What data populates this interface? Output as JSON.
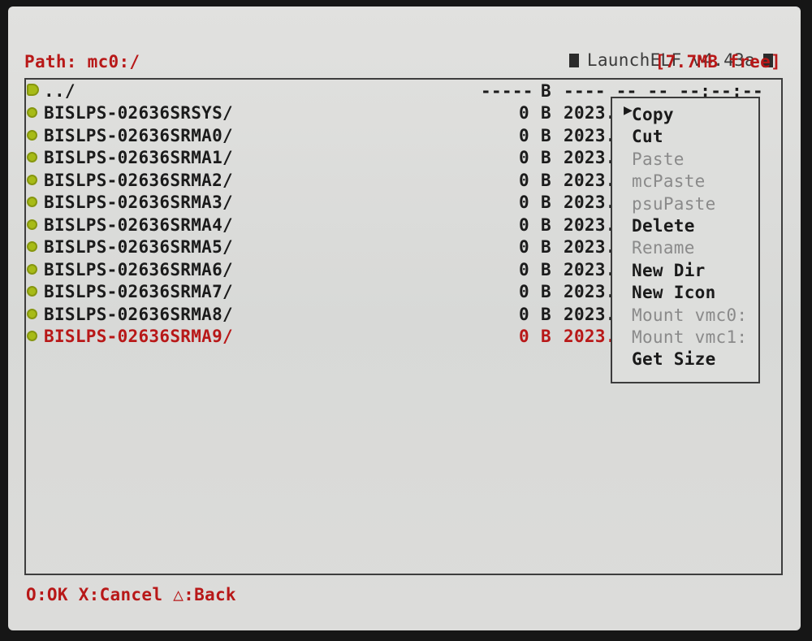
{
  "app": {
    "title": "LaunchELF v4.43a",
    "path": "Path: mc0:/",
    "free": "[7.7MB free]"
  },
  "files": {
    "header": {
      "name": "../",
      "size": "-----",
      "unit": "B",
      "date": "---- -- -- --:--:--"
    },
    "rows": [
      {
        "name": "BISLPS-02636SRSYS/",
        "size": "0",
        "unit": "B",
        "date": "2023."
      },
      {
        "name": "BISLPS-02636SRMA0/",
        "size": "0",
        "unit": "B",
        "date": "2023."
      },
      {
        "name": "BISLPS-02636SRMA1/",
        "size": "0",
        "unit": "B",
        "date": "2023."
      },
      {
        "name": "BISLPS-02636SRMA2/",
        "size": "0",
        "unit": "B",
        "date": "2023."
      },
      {
        "name": "BISLPS-02636SRMA3/",
        "size": "0",
        "unit": "B",
        "date": "2023."
      },
      {
        "name": "BISLPS-02636SRMA4/",
        "size": "0",
        "unit": "B",
        "date": "2023."
      },
      {
        "name": "BISLPS-02636SRMA5/",
        "size": "0",
        "unit": "B",
        "date": "2023."
      },
      {
        "name": "BISLPS-02636SRMA6/",
        "size": "0",
        "unit": "B",
        "date": "2023."
      },
      {
        "name": "BISLPS-02636SRMA7/",
        "size": "0",
        "unit": "B",
        "date": "2023."
      },
      {
        "name": "BISLPS-02636SRMA8/",
        "size": "0",
        "unit": "B",
        "date": "2023."
      },
      {
        "name": "BISLPS-02636SRMA9/",
        "size": "0",
        "unit": "B",
        "date": "2023.",
        "selected": true
      }
    ]
  },
  "menu": {
    "items": [
      {
        "label": "Copy",
        "enabled": true,
        "focused": true
      },
      {
        "label": "Cut",
        "enabled": true
      },
      {
        "label": "Paste",
        "enabled": false
      },
      {
        "label": "mcPaste",
        "enabled": false
      },
      {
        "label": "psuPaste",
        "enabled": false
      },
      {
        "label": "Delete",
        "enabled": true
      },
      {
        "label": "Rename",
        "enabled": false
      },
      {
        "label": "New Dir",
        "enabled": true
      },
      {
        "label": "New Icon",
        "enabled": true
      },
      {
        "label": "Mount vmc0:",
        "enabled": false
      },
      {
        "label": "Mount vmc1:",
        "enabled": false
      },
      {
        "label": "Get Size",
        "enabled": true
      }
    ],
    "cursor": "▶"
  },
  "footer": {
    "hint": "O:OK X:Cancel △:Back"
  },
  "colors": {
    "accent_red": "#b81818",
    "folder_icon": "#a7bb17",
    "screen_bg": "#dcdcda"
  }
}
